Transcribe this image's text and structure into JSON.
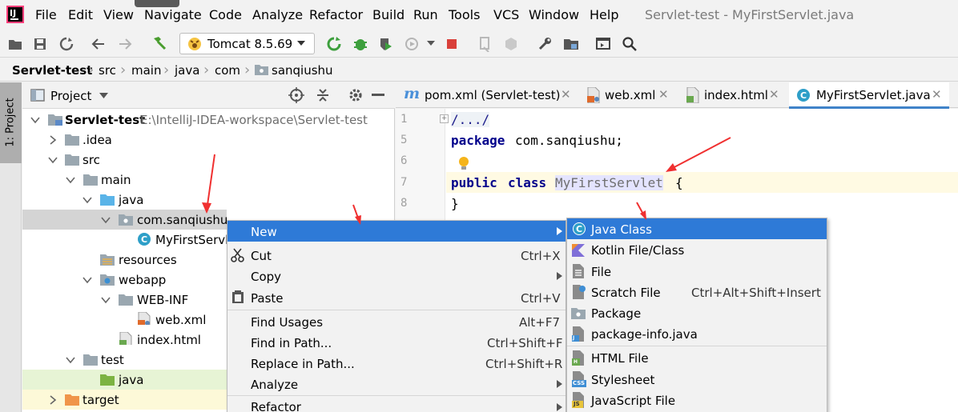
{
  "colors": {
    "accent": "#2e7ad7",
    "selection": "#d4d4d4",
    "highlight_row": "#e7f4d5",
    "class_icon": "#2e9fc8",
    "arrow": "#f03030"
  },
  "app": {
    "window_title": "Servlet-test - MyFirstServlet.java",
    "logo_text": "IJ"
  },
  "menu": [
    "File",
    "Edit",
    "View",
    "Navigate",
    "Code",
    "Analyze",
    "Refactor",
    "Build",
    "Run",
    "Tools",
    "VCS",
    "Window",
    "Help"
  ],
  "toolbar": {
    "run_config": "Tomcat 8.5.69"
  },
  "breadcrumb": [
    "Servlet-test",
    "src",
    "main",
    "java",
    "com",
    "sanqiushu"
  ],
  "sidebar": {
    "project_tab": "1: Project"
  },
  "panel": {
    "title": "Project"
  },
  "tree": [
    {
      "label": "Servlet-test",
      "hint": "E:\\IntelliJ-IDEA-workspace\\Servlet-test",
      "icon": "module-folder-icon"
    },
    {
      "label": ".idea",
      "icon": "folder-icon"
    },
    {
      "label": "src",
      "icon": "folder-icon"
    },
    {
      "label": "main",
      "icon": "folder-icon"
    },
    {
      "label": "java",
      "icon": "source-folder-icon"
    },
    {
      "label": "com.sanqiushu",
      "icon": "package-icon"
    },
    {
      "label": "MyFirstServlet",
      "icon": "java-class-icon"
    },
    {
      "label": "resources",
      "icon": "resources-folder-icon"
    },
    {
      "label": "webapp",
      "icon": "web-folder-icon"
    },
    {
      "label": "WEB-INF",
      "icon": "folder-icon"
    },
    {
      "label": "web.xml",
      "icon": "xml-file-icon"
    },
    {
      "label": "index.html",
      "icon": "html-file-icon"
    },
    {
      "label": "test",
      "icon": "folder-icon"
    },
    {
      "label": "java",
      "icon": "test-source-folder-icon"
    },
    {
      "label": "target",
      "icon": "excluded-folder-icon"
    }
  ],
  "tabs": [
    {
      "label": "pom.xml (Servlet-test)",
      "icon_text": "m"
    },
    {
      "label": "web.xml"
    },
    {
      "label": "index.html"
    },
    {
      "label": "MyFirstServlet.java",
      "icon_text": "C"
    }
  ],
  "editor": {
    "line_numbers": [
      "1",
      "5",
      "6",
      "7",
      "8"
    ],
    "lines": {
      "fold": "/.../",
      "kw_package": "package",
      "pkg_name": "com.sanqiushu;",
      "kw_public": "public",
      "kw_class": "class",
      "class_name": "MyFirstServlet",
      "brace_open": "{",
      "brace_close": "}"
    }
  },
  "context_menu": [
    {
      "label": "New",
      "shortcut": ""
    },
    {
      "label": "Cut",
      "shortcut": "Ctrl+X"
    },
    {
      "label": "Copy",
      "shortcut": ""
    },
    {
      "label": "Paste",
      "shortcut": "Ctrl+V"
    },
    {
      "label": "Find Usages",
      "shortcut": "Alt+F7"
    },
    {
      "label": "Find in Path...",
      "shortcut": "Ctrl+Shift+F"
    },
    {
      "label": "Replace in Path...",
      "shortcut": "Ctrl+Shift+R"
    },
    {
      "label": "Analyze",
      "shortcut": ""
    },
    {
      "label": "Refactor",
      "shortcut": ""
    }
  ],
  "submenu": [
    {
      "label": "Java Class",
      "shortcut": "",
      "icon_text": "C"
    },
    {
      "label": "Kotlin File/Class",
      "shortcut": ""
    },
    {
      "label": "File",
      "shortcut": ""
    },
    {
      "label": "Scratch File",
      "shortcut": "Ctrl+Alt+Shift+Insert"
    },
    {
      "label": "Package",
      "shortcut": ""
    },
    {
      "label": "package-info.java",
      "shortcut": "",
      "icon_text": "J"
    },
    {
      "label": "HTML File",
      "shortcut": "",
      "icon_text": "H"
    },
    {
      "label": "Stylesheet",
      "shortcut": "",
      "icon_text": "CSS"
    },
    {
      "label": "JavaScript File",
      "shortcut": "",
      "icon_text": "JS"
    }
  ]
}
